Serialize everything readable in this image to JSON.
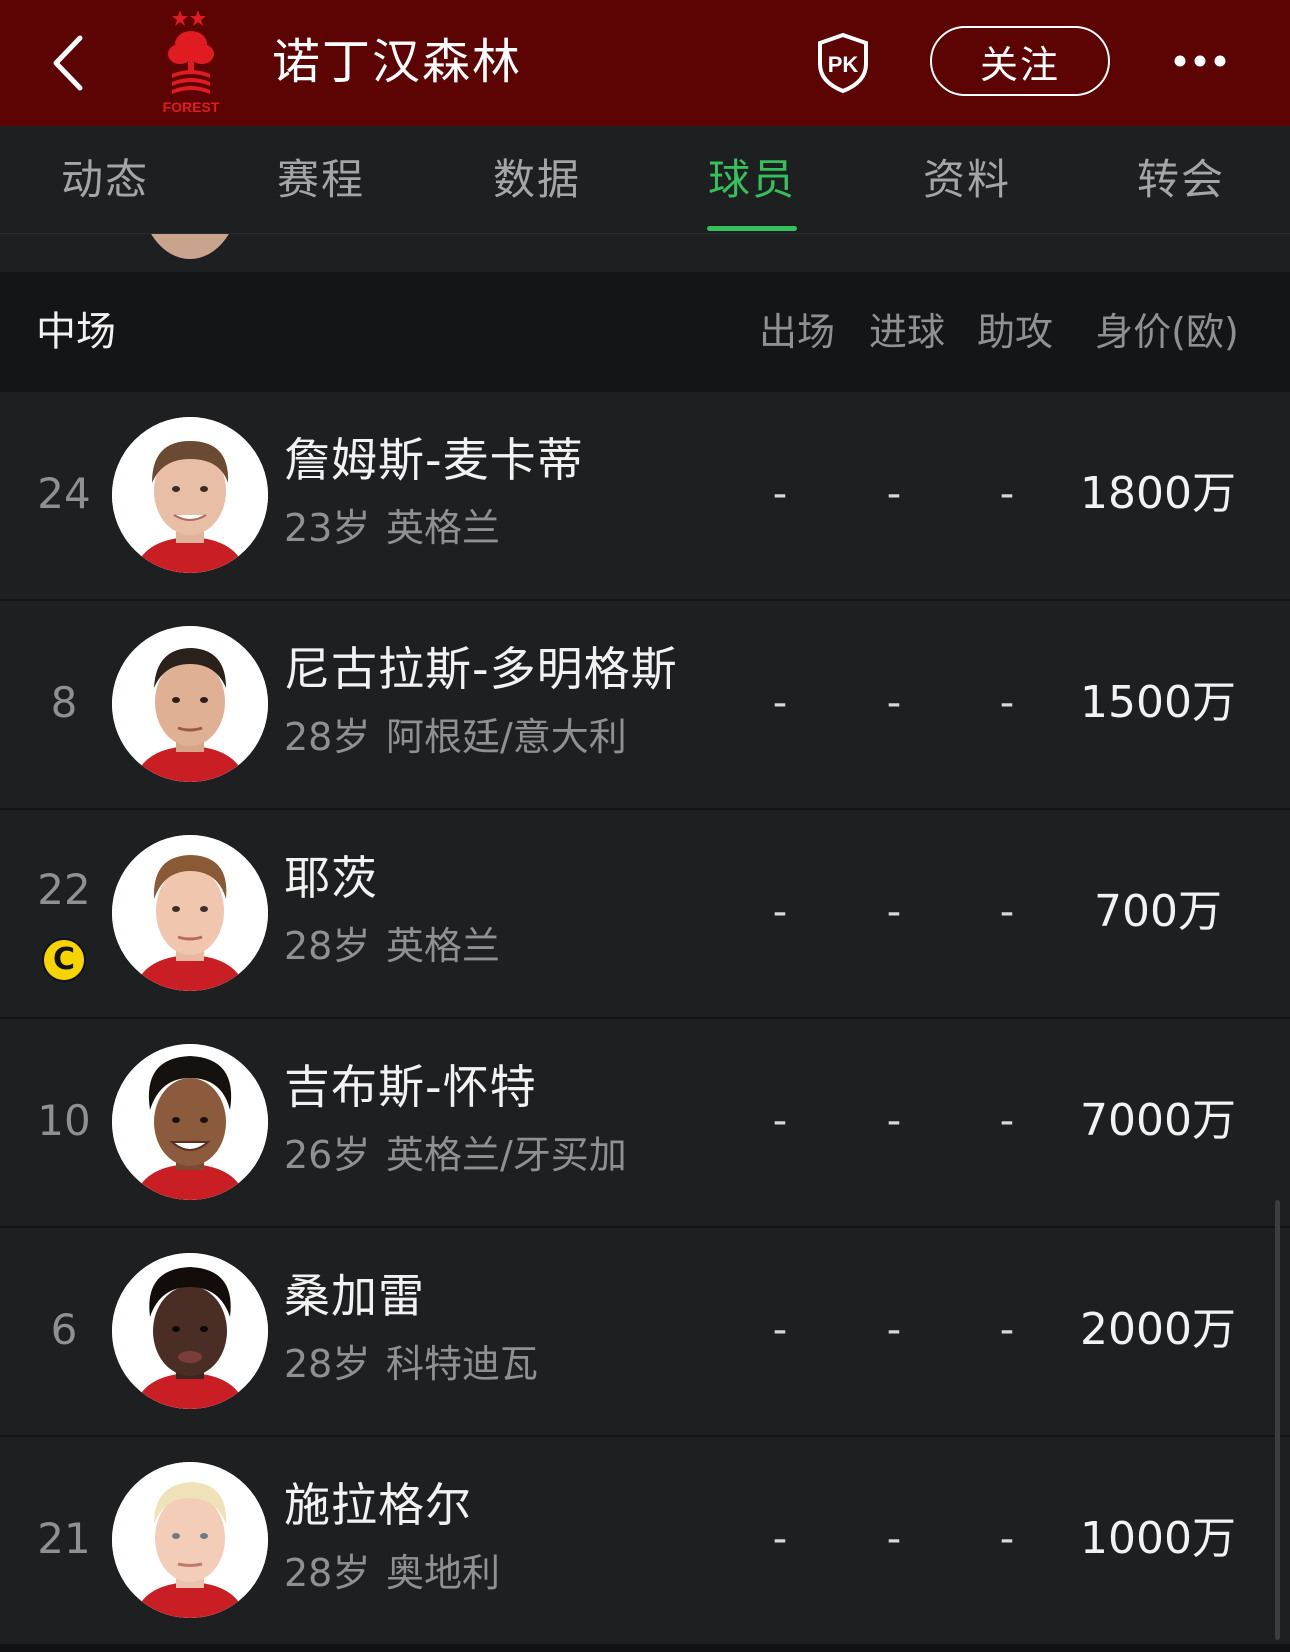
{
  "header": {
    "club_name": "诺丁汉森林",
    "logo_text": "FOREST",
    "follow_label": "关注",
    "pk_label": "PK",
    "brand_color": "#5c0304",
    "logo_color": "#e01b22"
  },
  "tabs": [
    {
      "label": "动态"
    },
    {
      "label": "赛程"
    },
    {
      "label": "数据"
    },
    {
      "label": "球员",
      "active": true
    },
    {
      "label": "资料"
    },
    {
      "label": "转会"
    }
  ],
  "accent_color": "#34c05a",
  "section": {
    "title": "中场",
    "columns": [
      "出场",
      "进球",
      "助攻",
      "身价(欧)"
    ]
  },
  "players": [
    {
      "number": "24",
      "name": "詹姆斯-麦卡蒂",
      "age": "23岁",
      "country": "英格兰",
      "appearances": "-",
      "goals": "-",
      "assists": "-",
      "value": "1800万",
      "captain": false
    },
    {
      "number": "8",
      "name": "尼古拉斯-多明格斯",
      "age": "28岁",
      "country": "阿根廷/意大利",
      "appearances": "-",
      "goals": "-",
      "assists": "-",
      "value": "1500万",
      "captain": false
    },
    {
      "number": "22",
      "name": "耶茨",
      "age": "28岁",
      "country": "英格兰",
      "appearances": "-",
      "goals": "-",
      "assists": "-",
      "value": "700万",
      "captain": true,
      "captain_label": "C"
    },
    {
      "number": "10",
      "name": "吉布斯-怀特",
      "age": "26岁",
      "country": "英格兰/牙买加",
      "appearances": "-",
      "goals": "-",
      "assists": "-",
      "value": "7000万",
      "captain": false
    },
    {
      "number": "6",
      "name": "桑加雷",
      "age": "28岁",
      "country": "科特迪瓦",
      "appearances": "-",
      "goals": "-",
      "assists": "-",
      "value": "2000万",
      "captain": false
    },
    {
      "number": "21",
      "name": "施拉格尔",
      "age": "28岁",
      "country": "奥地利",
      "appearances": "-",
      "goals": "-",
      "assists": "-",
      "value": "1000万",
      "captain": false
    }
  ]
}
